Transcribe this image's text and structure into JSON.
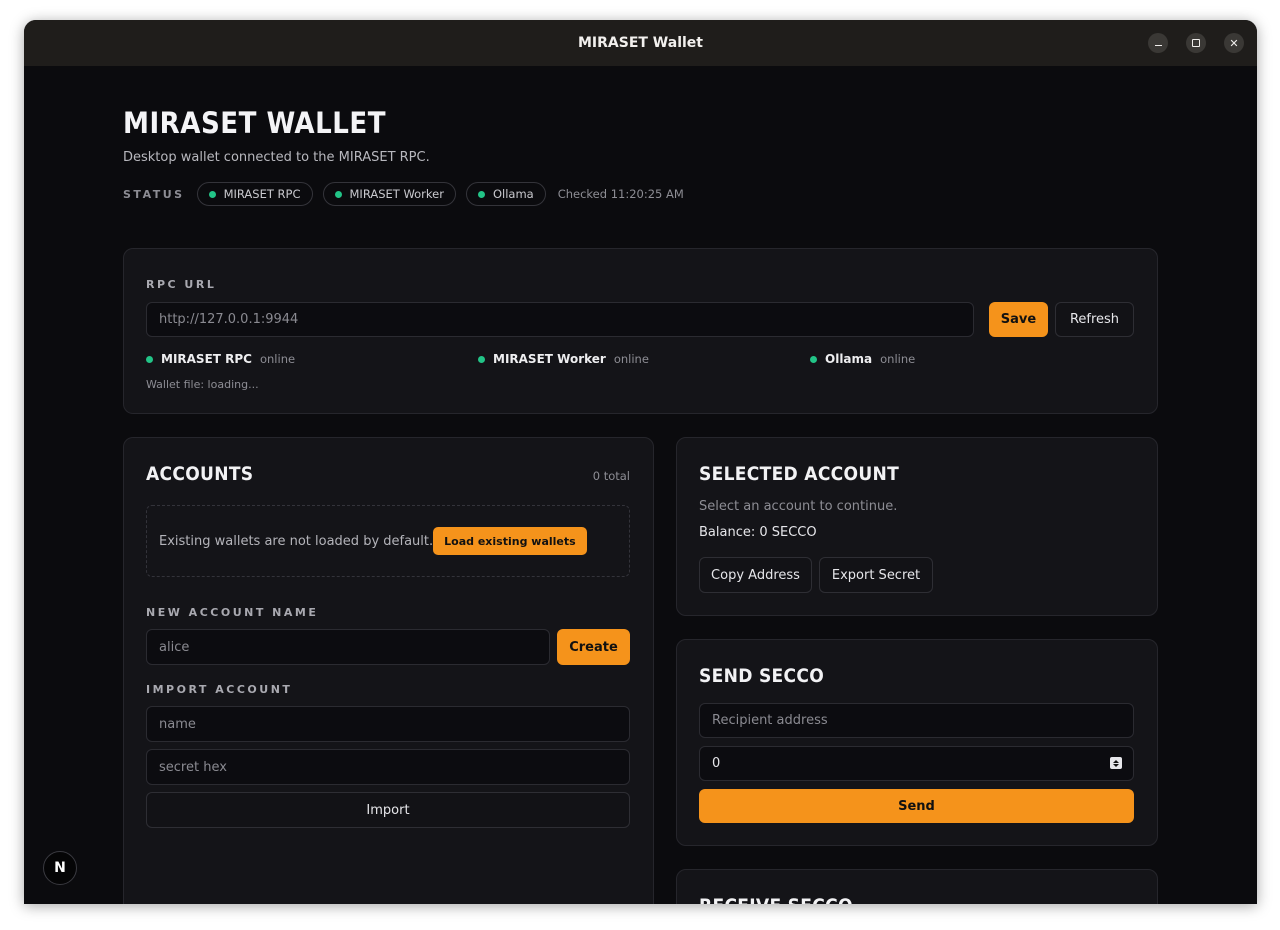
{
  "window": {
    "title": "MIRASET Wallet"
  },
  "header": {
    "title": "MIRASET WALLET",
    "subtitle": "Desktop wallet connected to the MIRASET RPC.",
    "status_label": "STATUS",
    "status_pills": [
      {
        "label": "MIRASET RPC",
        "color": "#22c487"
      },
      {
        "label": "MIRASET Worker",
        "color": "#22c487"
      },
      {
        "label": "Ollama",
        "color": "#22c487"
      }
    ],
    "checked": "Checked 11:20:25 AM"
  },
  "rpc": {
    "label": "RPC URL",
    "url_placeholder": "http://127.0.0.1:9944",
    "save_label": "Save",
    "refresh_label": "Refresh",
    "services": [
      {
        "name": "MIRASET RPC",
        "state": "online"
      },
      {
        "name": "MIRASET Worker",
        "state": "online"
      },
      {
        "name": "Ollama",
        "state": "online"
      }
    ],
    "wallet_file": "Wallet file: loading..."
  },
  "accounts": {
    "title": "ACCOUNTS",
    "total": "0 total",
    "empty_text": "Existing wallets are not loaded by default.",
    "load_label": "Load existing wallets",
    "new_name_label": "NEW ACCOUNT NAME",
    "new_name_placeholder": "alice",
    "create_label": "Create",
    "import_label": "IMPORT ACCOUNT",
    "import_name_placeholder": "name",
    "import_secret_placeholder": "secret hex",
    "import_button": "Import"
  },
  "selected": {
    "title": "SELECTED ACCOUNT",
    "hint": "Select an account to continue.",
    "balance": "Balance: 0 SECCO",
    "copy_label": "Copy Address",
    "export_label": "Export Secret"
  },
  "send": {
    "title": "SEND SECCO",
    "recipient_placeholder": "Recipient address",
    "amount_value": "0",
    "send_label": "Send"
  },
  "receive": {
    "title": "RECEIVE SECCO"
  },
  "dev_badge": {
    "letter": "N"
  },
  "colors": {
    "accent": "#f5931b",
    "online": "#22c487",
    "background": "#0b0b0e"
  }
}
